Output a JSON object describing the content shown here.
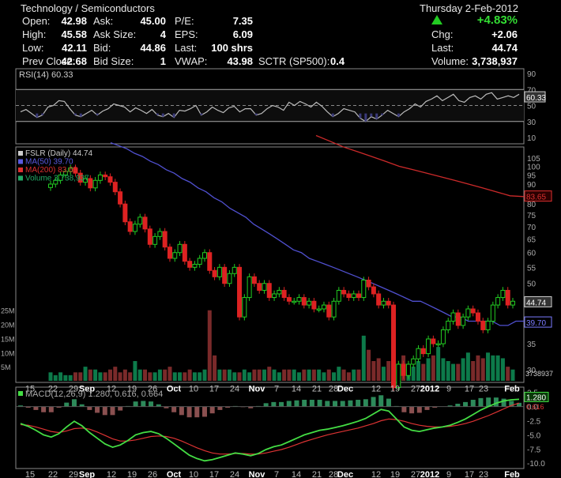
{
  "header": {
    "sector": "Technology / Semiconductors",
    "date": "Thursday  2-Feb-2012",
    "change_pct": "+4.83%",
    "rows": [
      {
        "l1": "Open:",
        "v1": "42.98",
        "l2": "Ask:",
        "v2": "45.00",
        "l3": "P/E:",
        "v3": "7.35"
      },
      {
        "l1": "High:",
        "v1": "45.58",
        "l2": "Ask Size:",
        "v2": "4",
        "l3": "EPS:",
        "v3": "6.09"
      },
      {
        "l1": "Low:",
        "v1": "42.11",
        "l2": "Bid:",
        "v2": "44.86",
        "l3": "Last:",
        "v3": "100 shrs"
      },
      {
        "l1": "Prev Close:",
        "v1": "42.68",
        "l2": "Bid Size:",
        "v2": "1",
        "l3": "VWAP:",
        "v3": "43.98"
      }
    ],
    "sctr_label": "SCTR (SP500):",
    "sctr_value": "0.4",
    "right_rows": [
      {
        "label": "Chg:",
        "value": "+2.06"
      },
      {
        "label": "Last:",
        "value": "44.74"
      },
      {
        "label": "Volume:",
        "value": "3,738,937"
      }
    ]
  },
  "chart_data": [
    {
      "type": "line",
      "title": "RSI(14) 60.33",
      "ylim": [
        0,
        100
      ],
      "ticks": [
        "90",
        "70",
        "50",
        "30",
        "10"
      ],
      "current_label": "60.33",
      "reference_lines": [
        70,
        50,
        30
      ],
      "series": [
        {
          "name": "RSI(14)",
          "values": [
            42,
            45,
            40,
            35,
            38,
            48,
            50,
            56,
            55,
            46,
            38,
            36,
            40,
            44,
            38,
            43,
            46,
            52,
            50,
            48,
            42,
            47,
            44,
            40,
            45,
            38,
            36,
            40,
            35,
            44,
            43,
            46,
            50,
            38,
            42,
            48,
            44,
            41,
            47,
            49,
            42,
            46,
            46,
            38,
            40,
            46,
            50,
            48,
            44,
            54,
            50,
            55,
            52,
            48,
            54,
            49,
            42,
            36,
            40,
            46,
            44,
            42,
            34,
            30,
            36,
            33,
            38,
            44,
            40,
            36,
            42,
            46,
            52,
            48,
            55,
            58,
            62,
            56,
            60,
            64,
            56,
            54,
            60,
            62,
            58,
            64,
            66,
            58,
            60,
            62,
            60,
            64
          ]
        }
      ]
    },
    {
      "type": "candlestick",
      "title": "FSLR (Daily) 44.74",
      "y_scale": "log",
      "y_ticks": [
        "105",
        "100",
        "95",
        "90",
        "85",
        "80",
        "75",
        "70",
        "65",
        "60",
        "55",
        "50",
        "45",
        "40",
        "35",
        "30"
      ],
      "x_ticks": [
        "15",
        "22",
        "29",
        "Sep",
        "12",
        "19",
        "26",
        "Oct",
        "10",
        "17",
        "24",
        "Nov",
        "7",
        "14",
        "21",
        "28",
        "Dec",
        "12",
        "19",
        "27",
        "2012",
        "9",
        "17",
        "23",
        "Feb"
      ],
      "price_labels": {
        "last": "44.74",
        "ma50": "39.70",
        "ma200": "83.65",
        "volume_last": "3738937"
      },
      "legend": [
        {
          "name": "FSLR (Daily) 44.74",
          "color": "#cccccc"
        },
        {
          "name": "MA(50) 39.70",
          "color": "#5a5ae0"
        },
        {
          "name": "MA(200) 83.65",
          "color": "#dd3030"
        },
        {
          "name": "Volume 3,738,937",
          "color": "#22aa66"
        }
      ],
      "volume_ticks": [
        "25M",
        "20M",
        "15M",
        "10M",
        "5M"
      ],
      "close": [
        90,
        92,
        95,
        97,
        99,
        96,
        91,
        93,
        88,
        92,
        95,
        94,
        91,
        86,
        80,
        72,
        68,
        71,
        74,
        69,
        63,
        66,
        68,
        62,
        58,
        60,
        63,
        57,
        55,
        56,
        58,
        60,
        54,
        52,
        55,
        50,
        53,
        55,
        41,
        46,
        52,
        50,
        48,
        50,
        46,
        47,
        48,
        46,
        45,
        45,
        46,
        44,
        45,
        43,
        43,
        44,
        41,
        45,
        48,
        47,
        46,
        47,
        46,
        51,
        49,
        47,
        44,
        45,
        44,
        27,
        31,
        29,
        31,
        32,
        34,
        33,
        36,
        35,
        35,
        38,
        40,
        42,
        39,
        41,
        43,
        42,
        40,
        38,
        40,
        44,
        46,
        48,
        44,
        45
      ],
      "ma50": [
        115,
        113,
        111,
        108,
        106,
        103,
        101,
        98,
        96,
        93,
        91,
        88,
        86,
        83,
        81,
        78,
        76,
        74,
        71,
        69,
        67,
        65,
        63,
        61,
        60,
        58,
        57,
        56,
        55,
        54,
        53,
        52,
        51,
        50,
        49,
        48,
        47,
        46,
        45,
        45,
        44,
        43,
        42,
        41,
        41,
        40,
        40,
        40,
        40,
        39,
        39,
        40,
        40
      ],
      "ma200": [
        120,
        116,
        112,
        109,
        106,
        103,
        100,
        98,
        96,
        94,
        92,
        90,
        88,
        86,
        84,
        83.6
      ],
      "volume": [
        3,
        2,
        3,
        2,
        2,
        3,
        3,
        5,
        4,
        4,
        3,
        3,
        4,
        5,
        3,
        4,
        3,
        7,
        4,
        4,
        3,
        3,
        4,
        4,
        5,
        3,
        3,
        3,
        4,
        3,
        3,
        4,
        25,
        9,
        4,
        4,
        4,
        3,
        3,
        4,
        3,
        4,
        4,
        4,
        5,
        4,
        3,
        4,
        4,
        4,
        3,
        4,
        4,
        4,
        4,
        3,
        4,
        3,
        5,
        4,
        3,
        4,
        4,
        16,
        11,
        7,
        8,
        5,
        7,
        4,
        5,
        9,
        6,
        5,
        7,
        6,
        8,
        9,
        12,
        8,
        7,
        6,
        6,
        8,
        10,
        7,
        9,
        8,
        10,
        9,
        9,
        8,
        5,
        4
      ]
    },
    {
      "type": "line",
      "title": "MACD(12,26,9) 1.280, 0.616, 0.664",
      "y_ticks": [
        "2.5",
        "0.0",
        "-2.5",
        "-5.0",
        "-7.5",
        "-10.0"
      ],
      "current_labels": [
        "1.280",
        "0.616"
      ],
      "series": [
        {
          "name": "MACD",
          "color": "#44dd44",
          "values": [
            -3,
            -3.5,
            -4.2,
            -5,
            -5.4,
            -4.8,
            -3.6,
            -2.6,
            -3.4,
            -4.6,
            -5.6,
            -6.6,
            -7.2,
            -6.8,
            -6,
            -5,
            -4.6,
            -4.4,
            -4.8,
            -5.6,
            -6.6,
            -7.6,
            -8.6,
            -9.2,
            -9.6,
            -9.4,
            -9,
            -8.6,
            -8.2,
            -8.4,
            -8.7,
            -8.3,
            -7.6,
            -7.1,
            -6.8,
            -6.2,
            -5.6,
            -5,
            -4.6,
            -4.2,
            -4,
            -3.7,
            -3.4,
            -3.0,
            -2.6,
            -2.1,
            -1.3,
            -0.5,
            -0.8,
            -2.2,
            -3.6,
            -4.2,
            -4.4,
            -4.1,
            -3.8,
            -3.6,
            -3.3,
            -2.8,
            -2.2,
            -1.4,
            -0.6,
            0.0,
            0.6,
            1.0,
            1.2,
            1.28
          ]
        },
        {
          "name": "Signal",
          "color": "#dd3333",
          "values": [
            -3.2,
            -3.3,
            -3.6,
            -4,
            -4.4,
            -4.6,
            -4.3,
            -3.9,
            -3.8,
            -4.0,
            -4.5,
            -5.1,
            -5.7,
            -6.1,
            -6.1,
            -5.9,
            -5.6,
            -5.3,
            -5.2,
            -5.3,
            -5.6,
            -6.1,
            -6.7,
            -7.3,
            -7.8,
            -8.2,
            -8.4,
            -8.4,
            -8.3,
            -8.3,
            -8.4,
            -8.4,
            -8.2,
            -7.9,
            -7.6,
            -7.2,
            -6.7,
            -6.2,
            -5.8,
            -5.4,
            -5.0,
            -4.7,
            -4.4,
            -4.1,
            -3.8,
            -3.4,
            -3.0,
            -2.5,
            -2.2,
            -2.3,
            -2.6,
            -3.0,
            -3.3,
            -3.5,
            -3.6,
            -3.6,
            -3.5,
            -3.3,
            -3.0,
            -2.6,
            -2.1,
            -1.6,
            -1.0,
            -0.4,
            0.2,
            0.616
          ]
        },
        {
          "name": "Histogram",
          "color": "#775555",
          "values": [
            0.2,
            -0.2,
            -0.6,
            -1,
            -1,
            -0.2,
            0.7,
            1.3,
            0.4,
            -0.6,
            -1.1,
            -1.5,
            -1.5,
            -0.7,
            0.1,
            0.9,
            1.0,
            0.9,
            0.4,
            -0.3,
            -1,
            -1.5,
            -1.9,
            -1.9,
            -1.8,
            -1.2,
            -0.6,
            -0.2,
            0.1,
            -0.1,
            -0.3,
            0.1,
            0.6,
            0.8,
            0.8,
            1.0,
            1.1,
            1.2,
            1.2,
            1.2,
            1.0,
            1.0,
            1.0,
            1.1,
            1.2,
            1.3,
            1.7,
            2.0,
            1.4,
            0.1,
            -1,
            -1.2,
            -1.1,
            -0.6,
            -0.2,
            0,
            0.2,
            0.5,
            0.8,
            1.2,
            1.5,
            1.6,
            1.6,
            1.4,
            1.0,
            0.664
          ]
        }
      ],
      "x_ticks": [
        "15",
        "22",
        "29",
        "Sep",
        "12",
        "19",
        "26",
        "Oct",
        "10",
        "17",
        "24",
        "Nov",
        "7",
        "14",
        "21",
        "28",
        "Dec",
        "12",
        "19",
        "27",
        "2012",
        "9",
        "17",
        "23",
        "Feb"
      ]
    }
  ]
}
